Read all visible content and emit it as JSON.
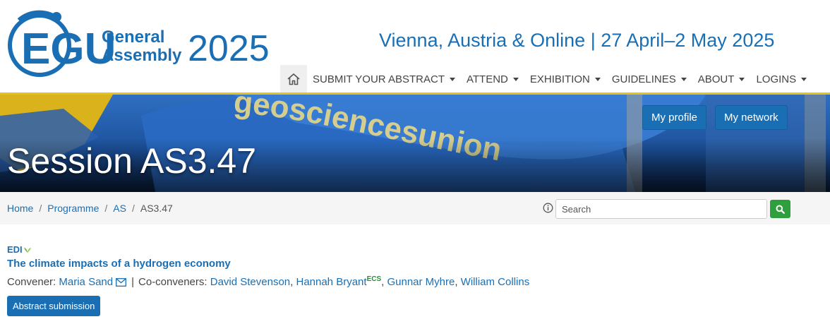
{
  "header": {
    "logo": {
      "letters": "EGU",
      "line1": "General",
      "line2": "Assembly",
      "year": "2025"
    },
    "venue": "Vienna, Austria & Online | 27 April–2 May 2025"
  },
  "nav": {
    "items": [
      {
        "label": "SUBMIT YOUR ABSTRACT"
      },
      {
        "label": "ATTEND"
      },
      {
        "label": "EXHIBITION"
      },
      {
        "label": "GUIDELINES"
      },
      {
        "label": "ABOUT"
      },
      {
        "label": "LOGINS"
      }
    ]
  },
  "banner": {
    "title": "Session AS3.47",
    "my_profile": "My profile",
    "my_network": "My network"
  },
  "breadcrumb": {
    "items": [
      "Home",
      "Programme",
      "AS"
    ],
    "current": "AS3.47",
    "separator": "/"
  },
  "search": {
    "placeholder": "Search"
  },
  "session": {
    "tag": "EDI",
    "title": "The climate impacts of a hydrogen economy",
    "convener_label": "Convener:",
    "convener": "Maria Sand",
    "coconveners_label": "Co-conveners:",
    "coconveners": {
      "c1": "David Stevenson",
      "c2": "Hannah Bryant",
      "c2_badge": "ECS",
      "c3": "Gunnar Myhre",
      "c4": "William Collins"
    },
    "comma": ",",
    "bar": "|",
    "submit_label": "Abstract submission"
  },
  "colors": {
    "brand_blue": "#1a6fb4",
    "accent_yellow": "#e5c21d",
    "search_green": "#2d9f3c",
    "ecs_green": "#2d8a3e"
  }
}
